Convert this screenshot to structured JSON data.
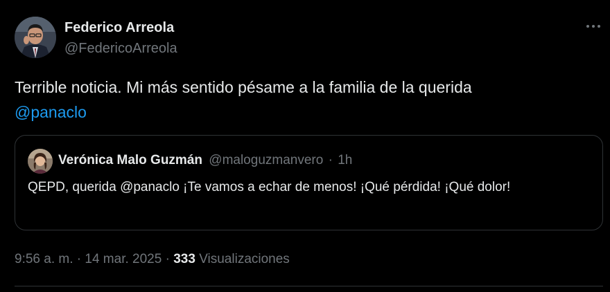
{
  "tweet": {
    "author": {
      "name": "Federico Arreola",
      "handle": "@FedericoArreola"
    },
    "text_before_mention": "Terrible noticia. Mi más sentido pésame a la familia de la querida",
    "mention": "@panaclo",
    "quoted": {
      "name": "Verónica Malo Guzmán",
      "handle": "@maloguzmanvero",
      "separator": "·",
      "time": "1h",
      "text": "QEPD, querida @panaclo ¡Te vamos a echar de menos! ¡Qué pérdida! ¡Qué dolor!"
    },
    "meta": {
      "time": "9:56 a. m.",
      "sep1": "·",
      "date": "14 mar. 2025",
      "sep2": "·",
      "views_count": "333",
      "views_label": "Visualizaciones"
    }
  },
  "icons": {
    "more": "more-horizontal-icon"
  },
  "colors": {
    "background": "#000000",
    "text_primary": "#e7e9ea",
    "text_secondary": "#71767b",
    "link": "#1d9bf0",
    "border": "#2f3336"
  }
}
